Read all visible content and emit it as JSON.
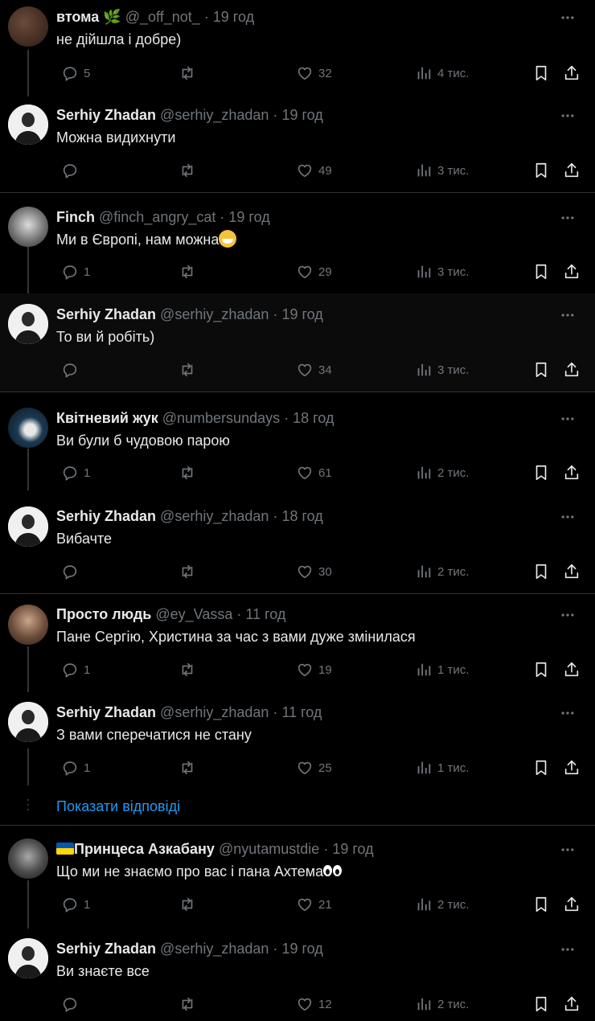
{
  "colors": {
    "background": "#000000",
    "text": "#e7e9ea",
    "secondary": "#71767b",
    "link": "#1d9bf0",
    "divider": "#2f3336"
  },
  "icons": {
    "reply": "reply-icon",
    "retweet": "retweet-icon",
    "like": "heart-icon",
    "views": "views-icon",
    "bookmark": "bookmark-icon",
    "share": "share-icon",
    "more": "more-icon"
  },
  "tweets": [
    {
      "name": "втома",
      "handle": "@_off_not_",
      "time": "19 год",
      "text": "не дійшла і добре)",
      "replies": "5",
      "likes": "32",
      "views": "4 тис."
    },
    {
      "name": "Serhiy Zhadan",
      "handle": "@serhiy_zhadan",
      "time": "19 год",
      "text": "Можна видихнути",
      "replies": "",
      "likes": "49",
      "views": "3 тис."
    },
    {
      "name": "Finch",
      "handle": "@finch_angry_cat",
      "time": "19 год",
      "text": "Ми в Європі, нам можна",
      "replies": "1",
      "likes": "29",
      "views": "3 тис."
    },
    {
      "name": "Serhiy Zhadan",
      "handle": "@serhiy_zhadan",
      "time": "19 год",
      "text": "То ви й робіть)",
      "replies": "",
      "likes": "34",
      "views": "3 тис."
    },
    {
      "name": "Квітневий жук",
      "handle": "@numbersundays",
      "time": "18 год",
      "text": "Ви були б чудовою парою",
      "replies": "1",
      "likes": "61",
      "views": "2 тис."
    },
    {
      "name": "Serhiy Zhadan",
      "handle": "@serhiy_zhadan",
      "time": "18 год",
      "text": "Вибачте",
      "replies": "",
      "likes": "30",
      "views": "2 тис."
    },
    {
      "name": "Просто людь",
      "handle": "@ey_Vassa",
      "time": "11 год",
      "text": "Пане Сергію, Христина за час з вами дуже змінилася",
      "replies": "1",
      "likes": "19",
      "views": "1 тис."
    },
    {
      "name": "Serhiy Zhadan",
      "handle": "@serhiy_zhadan",
      "time": "11 год",
      "text": "З вами сперечатися не стану",
      "replies": "1",
      "likes": "25",
      "views": "1 тис."
    },
    {
      "name": "Принцеса Азкабану",
      "handle": "@nyutamustdie",
      "time": "19 год",
      "text": "Що ми не знаємо про вас і пана Ахтема",
      "replies": "1",
      "likes": "21",
      "views": "2 тис."
    },
    {
      "name": "Serhiy Zhadan",
      "handle": "@serhiy_zhadan",
      "time": "19 год",
      "text": "Ви знаєте все",
      "replies": "",
      "likes": "12",
      "views": "2 тис."
    }
  ],
  "show_replies_label": "Показати відповіді"
}
